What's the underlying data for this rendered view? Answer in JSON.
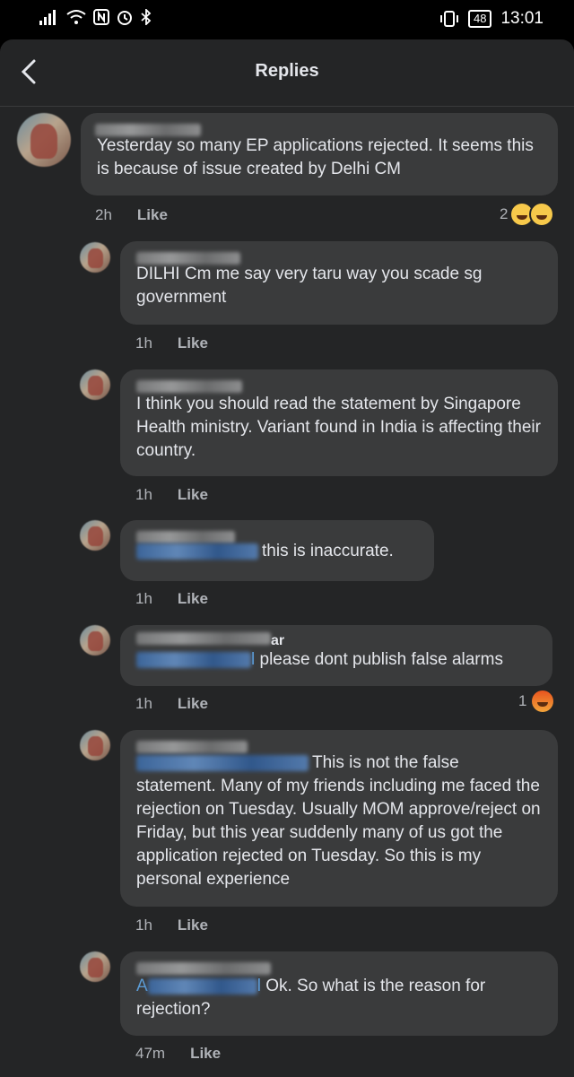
{
  "status": {
    "battery": "48",
    "time": "13:01",
    "icons": [
      "signal-icon",
      "wifi-icon",
      "nfc-icon",
      "alarm-icon",
      "bluetooth-icon",
      "vibrate-icon",
      "battery-icon"
    ]
  },
  "header": {
    "title": "Replies",
    "back_icon": "chevron-left-icon"
  },
  "comments": [
    {
      "text": "Yesterday so many EP applications rejected. It seems this is because of issue created by Delhi CM",
      "time": "2h",
      "like": "Like",
      "reaction_count": "2",
      "reactions": [
        "haha-icon",
        "sad-icon"
      ]
    },
    {
      "text": "DILHI Cm me say very taru way you scade sg government",
      "time": "1h",
      "like": "Like"
    },
    {
      "text": "I think you should read the statement by Singapore Health ministry. Variant found in India is affecting their country.",
      "time": "1h",
      "like": "Like"
    },
    {
      "text": "this is inaccurate.",
      "time": "1h",
      "like": "Like"
    },
    {
      "name_suffix": "ar",
      "tag_tail": "l",
      "text": "please dont publish false alarms",
      "time": "1h",
      "like": "Like",
      "reaction_count": "1",
      "reactions": [
        "angry-icon"
      ]
    },
    {
      "text": "This is not the false statement. Many of my friends including me faced the rejection on Tuesday. Usually MOM approve/reject on Friday, but this year suddenly many of us got the application rejected on Tuesday. So this is my personal experience",
      "time": "1h",
      "like": "Like"
    },
    {
      "tag_head": "A",
      "tag_tail": "l",
      "text": "Ok. So what is the reason for rejection?",
      "time": "47m",
      "like": "Like"
    }
  ]
}
